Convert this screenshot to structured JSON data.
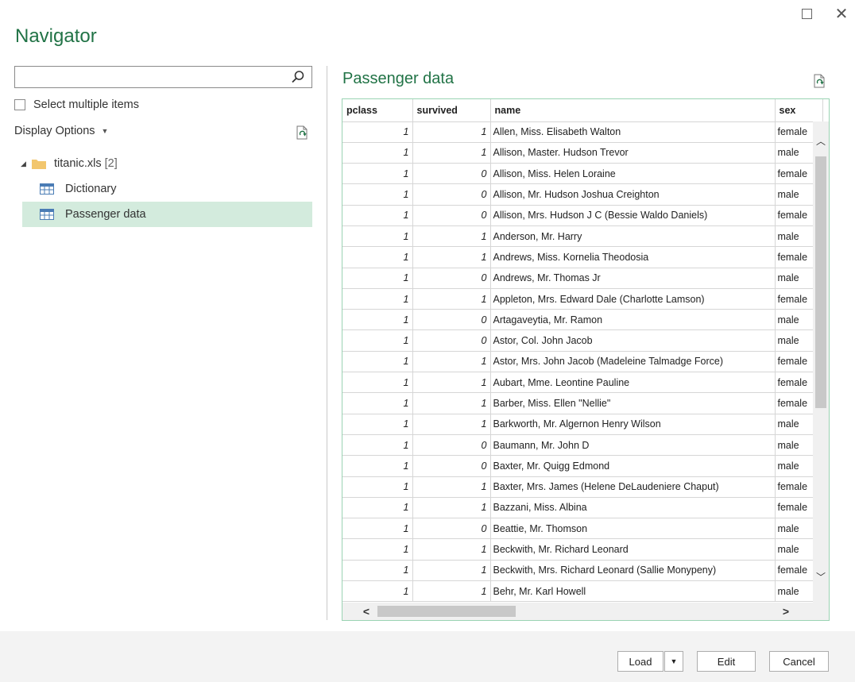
{
  "window": {
    "title": "Navigator",
    "maximize_icon": "maximize-icon",
    "close_icon": "close-icon"
  },
  "left": {
    "search": {
      "value": "",
      "placeholder": ""
    },
    "select_multiple_label": "Select multiple items",
    "display_options_label": "Display Options",
    "tree": {
      "root": {
        "label": "titanic.xls",
        "count": "[2]"
      },
      "items": [
        {
          "label": "Dictionary",
          "selected": false
        },
        {
          "label": "Passenger data",
          "selected": true
        }
      ]
    }
  },
  "preview": {
    "title": "Passenger data",
    "columns": [
      "pclass",
      "survived",
      "name",
      "sex"
    ],
    "rows": [
      [
        "1",
        "1",
        "Allen, Miss. Elisabeth Walton",
        "female"
      ],
      [
        "1",
        "1",
        "Allison, Master. Hudson Trevor",
        "male"
      ],
      [
        "1",
        "0",
        "Allison, Miss. Helen Loraine",
        "female"
      ],
      [
        "1",
        "0",
        "Allison, Mr. Hudson Joshua Creighton",
        "male"
      ],
      [
        "1",
        "0",
        "Allison, Mrs. Hudson J C (Bessie Waldo Daniels)",
        "female"
      ],
      [
        "1",
        "1",
        "Anderson, Mr. Harry",
        "male"
      ],
      [
        "1",
        "1",
        "Andrews, Miss. Kornelia Theodosia",
        "female"
      ],
      [
        "1",
        "0",
        "Andrews, Mr. Thomas Jr",
        "male"
      ],
      [
        "1",
        "1",
        "Appleton, Mrs. Edward Dale (Charlotte Lamson)",
        "female"
      ],
      [
        "1",
        "0",
        "Artagaveytia, Mr. Ramon",
        "male"
      ],
      [
        "1",
        "0",
        "Astor, Col. John Jacob",
        "male"
      ],
      [
        "1",
        "1",
        "Astor, Mrs. John Jacob (Madeleine Talmadge Force)",
        "female"
      ],
      [
        "1",
        "1",
        "Aubart, Mme. Leontine Pauline",
        "female"
      ],
      [
        "1",
        "1",
        "Barber, Miss. Ellen \"Nellie\"",
        "female"
      ],
      [
        "1",
        "1",
        "Barkworth, Mr. Algernon Henry Wilson",
        "male"
      ],
      [
        "1",
        "0",
        "Baumann, Mr. John D",
        "male"
      ],
      [
        "1",
        "0",
        "Baxter, Mr. Quigg Edmond",
        "male"
      ],
      [
        "1",
        "1",
        "Baxter, Mrs. James (Helene DeLaudeniere Chaput)",
        "female"
      ],
      [
        "1",
        "1",
        "Bazzani, Miss. Albina",
        "female"
      ],
      [
        "1",
        "0",
        "Beattie, Mr. Thomson",
        "male"
      ],
      [
        "1",
        "1",
        "Beckwith, Mr. Richard Leonard",
        "male"
      ],
      [
        "1",
        "1",
        "Beckwith, Mrs. Richard Leonard (Sallie Monypeny)",
        "female"
      ],
      [
        "1",
        "1",
        "Behr, Mr. Karl Howell",
        "male"
      ]
    ]
  },
  "footer": {
    "load_label": "Load",
    "edit_label": "Edit",
    "cancel_label": "Cancel"
  },
  "colors": {
    "accent": "#217346",
    "selection": "#d3ebdd",
    "grid_border": "#9ad3b3"
  }
}
